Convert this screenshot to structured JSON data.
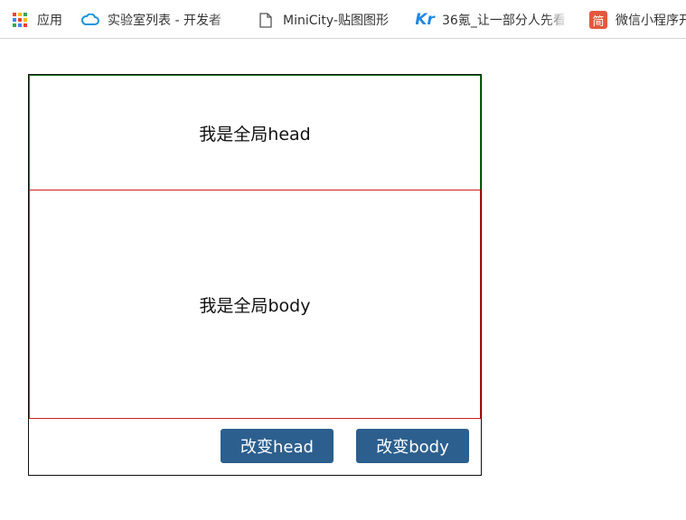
{
  "bookmarks": [
    {
      "label": "应用",
      "icon": "apps-grid-icon"
    },
    {
      "label": "实验室列表 - 开发者",
      "icon": "cloud-icon"
    },
    {
      "label": "MiniCity-贴图图形",
      "icon": "page-icon"
    },
    {
      "label": "36氪_让一部分人先看",
      "icon": "kr-icon"
    },
    {
      "label": "微信小程序开",
      "icon": "jian-icon"
    }
  ],
  "panel": {
    "head_text": "我是全局head",
    "body_text": "我是全局body",
    "change_head_label": "改变head",
    "change_body_label": "改变body"
  },
  "colors": {
    "button_bg": "#2c5f8e",
    "head_border": "#1a7a1a",
    "body_border": "#cc1f1f"
  }
}
